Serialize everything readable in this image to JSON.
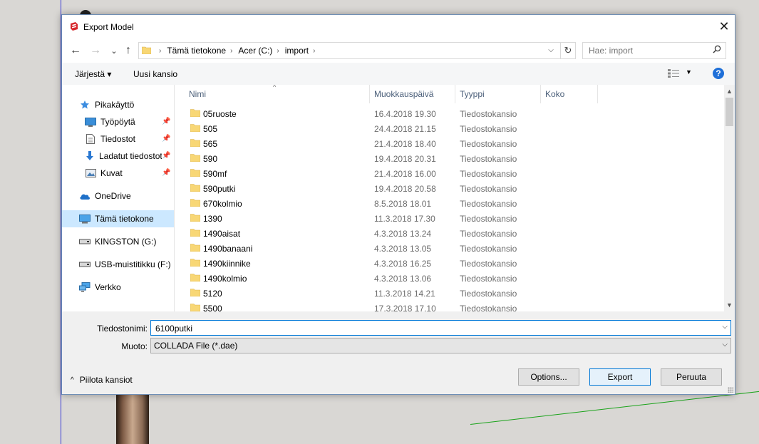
{
  "window": {
    "title": "Export Model",
    "close_glyph": "✕"
  },
  "nav": {
    "back_glyph": "←",
    "forward_glyph": "→",
    "recent_glyph": "⌄",
    "up_glyph": "↑",
    "breadcrumbs": [
      "Tämä tietokone",
      "Acer (C:)",
      "import"
    ],
    "crumb_sep": "›",
    "refresh_glyph": "↻",
    "search_placeholder": "Hae: import",
    "search_glyph": "⚲"
  },
  "commandbar": {
    "organize": "Järjestä ▾",
    "new_folder": "Uusi kansio",
    "view_dd": "▼",
    "help": "?"
  },
  "navpane": {
    "items": [
      {
        "label": "Pikakäyttö",
        "icon": "star-icon",
        "pinned": false
      },
      {
        "label": "Työpöytä",
        "icon": "desktop-icon",
        "pinned": true
      },
      {
        "label": "Tiedostot",
        "icon": "documents-icon",
        "pinned": true
      },
      {
        "label": "Ladatut tiedostot",
        "icon": "download-icon",
        "pinned": true
      },
      {
        "label": "Kuvat",
        "icon": "pictures-icon",
        "pinned": true
      },
      {
        "label": "OneDrive",
        "icon": "cloud-icon",
        "pinned": false
      },
      {
        "label": "Tämä tietokone",
        "icon": "computer-icon",
        "pinned": false
      },
      {
        "label": "KINGSTON (G:)",
        "icon": "drive-icon",
        "pinned": false
      },
      {
        "label": "USB-muistitikku (F:)",
        "icon": "drive-icon",
        "pinned": false
      },
      {
        "label": "Verkko",
        "icon": "network-icon",
        "pinned": false
      }
    ],
    "pin_glyph": "📌"
  },
  "filelist": {
    "columns": [
      "Nimi",
      "Muokkauspäivä",
      "Tyyppi",
      "Koko"
    ],
    "sort_glyph": "^",
    "rows": [
      {
        "name": "05ruoste",
        "date": "16.4.2018 19.30",
        "type": "Tiedostokansio"
      },
      {
        "name": "505",
        "date": "24.4.2018 21.15",
        "type": "Tiedostokansio"
      },
      {
        "name": "565",
        "date": "21.4.2018 18.40",
        "type": "Tiedostokansio"
      },
      {
        "name": "590",
        "date": "19.4.2018 20.31",
        "type": "Tiedostokansio"
      },
      {
        "name": "590mf",
        "date": "21.4.2018 16.00",
        "type": "Tiedostokansio"
      },
      {
        "name": "590putki",
        "date": "19.4.2018 20.58",
        "type": "Tiedostokansio"
      },
      {
        "name": "670kolmio",
        "date": "8.5.2018 18.01",
        "type": "Tiedostokansio"
      },
      {
        "name": "1390",
        "date": "11.3.2018 17.30",
        "type": "Tiedostokansio"
      },
      {
        "name": "1490aisat",
        "date": "4.3.2018 13.24",
        "type": "Tiedostokansio"
      },
      {
        "name": "1490banaani",
        "date": "4.3.2018 13.05",
        "type": "Tiedostokansio"
      },
      {
        "name": "1490kiinnike",
        "date": "4.3.2018 16.25",
        "type": "Tiedostokansio"
      },
      {
        "name": "1490kolmio",
        "date": "4.3.2018 13.06",
        "type": "Tiedostokansio"
      },
      {
        "name": "5120",
        "date": "11.3.2018 14.21",
        "type": "Tiedostokansio"
      },
      {
        "name": "5500",
        "date": "17.3.2018 17.10",
        "type": "Tiedostokansio"
      }
    ]
  },
  "scroll": {
    "up": "▲",
    "down": "▼"
  },
  "form": {
    "filename_label": "Tiedostonimi:",
    "filename_value": "6100putki",
    "type_label": "Muoto:",
    "type_value": "COLLADA File (*.dae)",
    "dd_glyph": "⌵"
  },
  "footer": {
    "hide_folders": "Piilota kansiot",
    "chev": "^",
    "options": "Options...",
    "export": "Export",
    "cancel": "Peruuta"
  }
}
